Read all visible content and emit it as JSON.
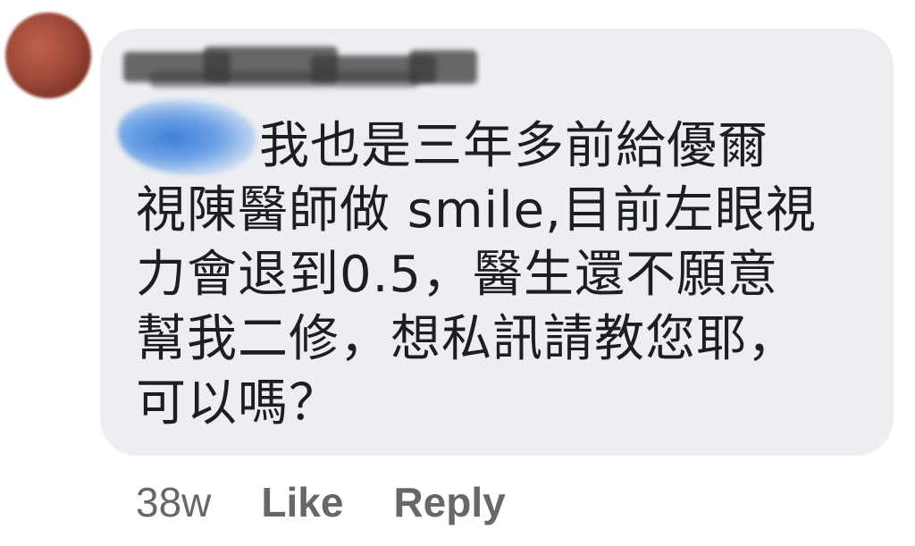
{
  "comment": {
    "text_lines": [
      "我也是三年多前給優爾",
      "視陳醫師做 smile,目前左眼視",
      "力會退到0.5，醫生還不願意",
      "幫我二修，想私訊請教您耶，",
      "可以嗎？"
    ]
  },
  "meta": {
    "timestamp": "38w",
    "like_label": "Like",
    "reply_label": "Reply"
  },
  "colors": {
    "bubble_background": "#eceef1",
    "text": "#1c1e21",
    "meta_text": "#65676b",
    "mention_blur": "#3d7fd8"
  }
}
